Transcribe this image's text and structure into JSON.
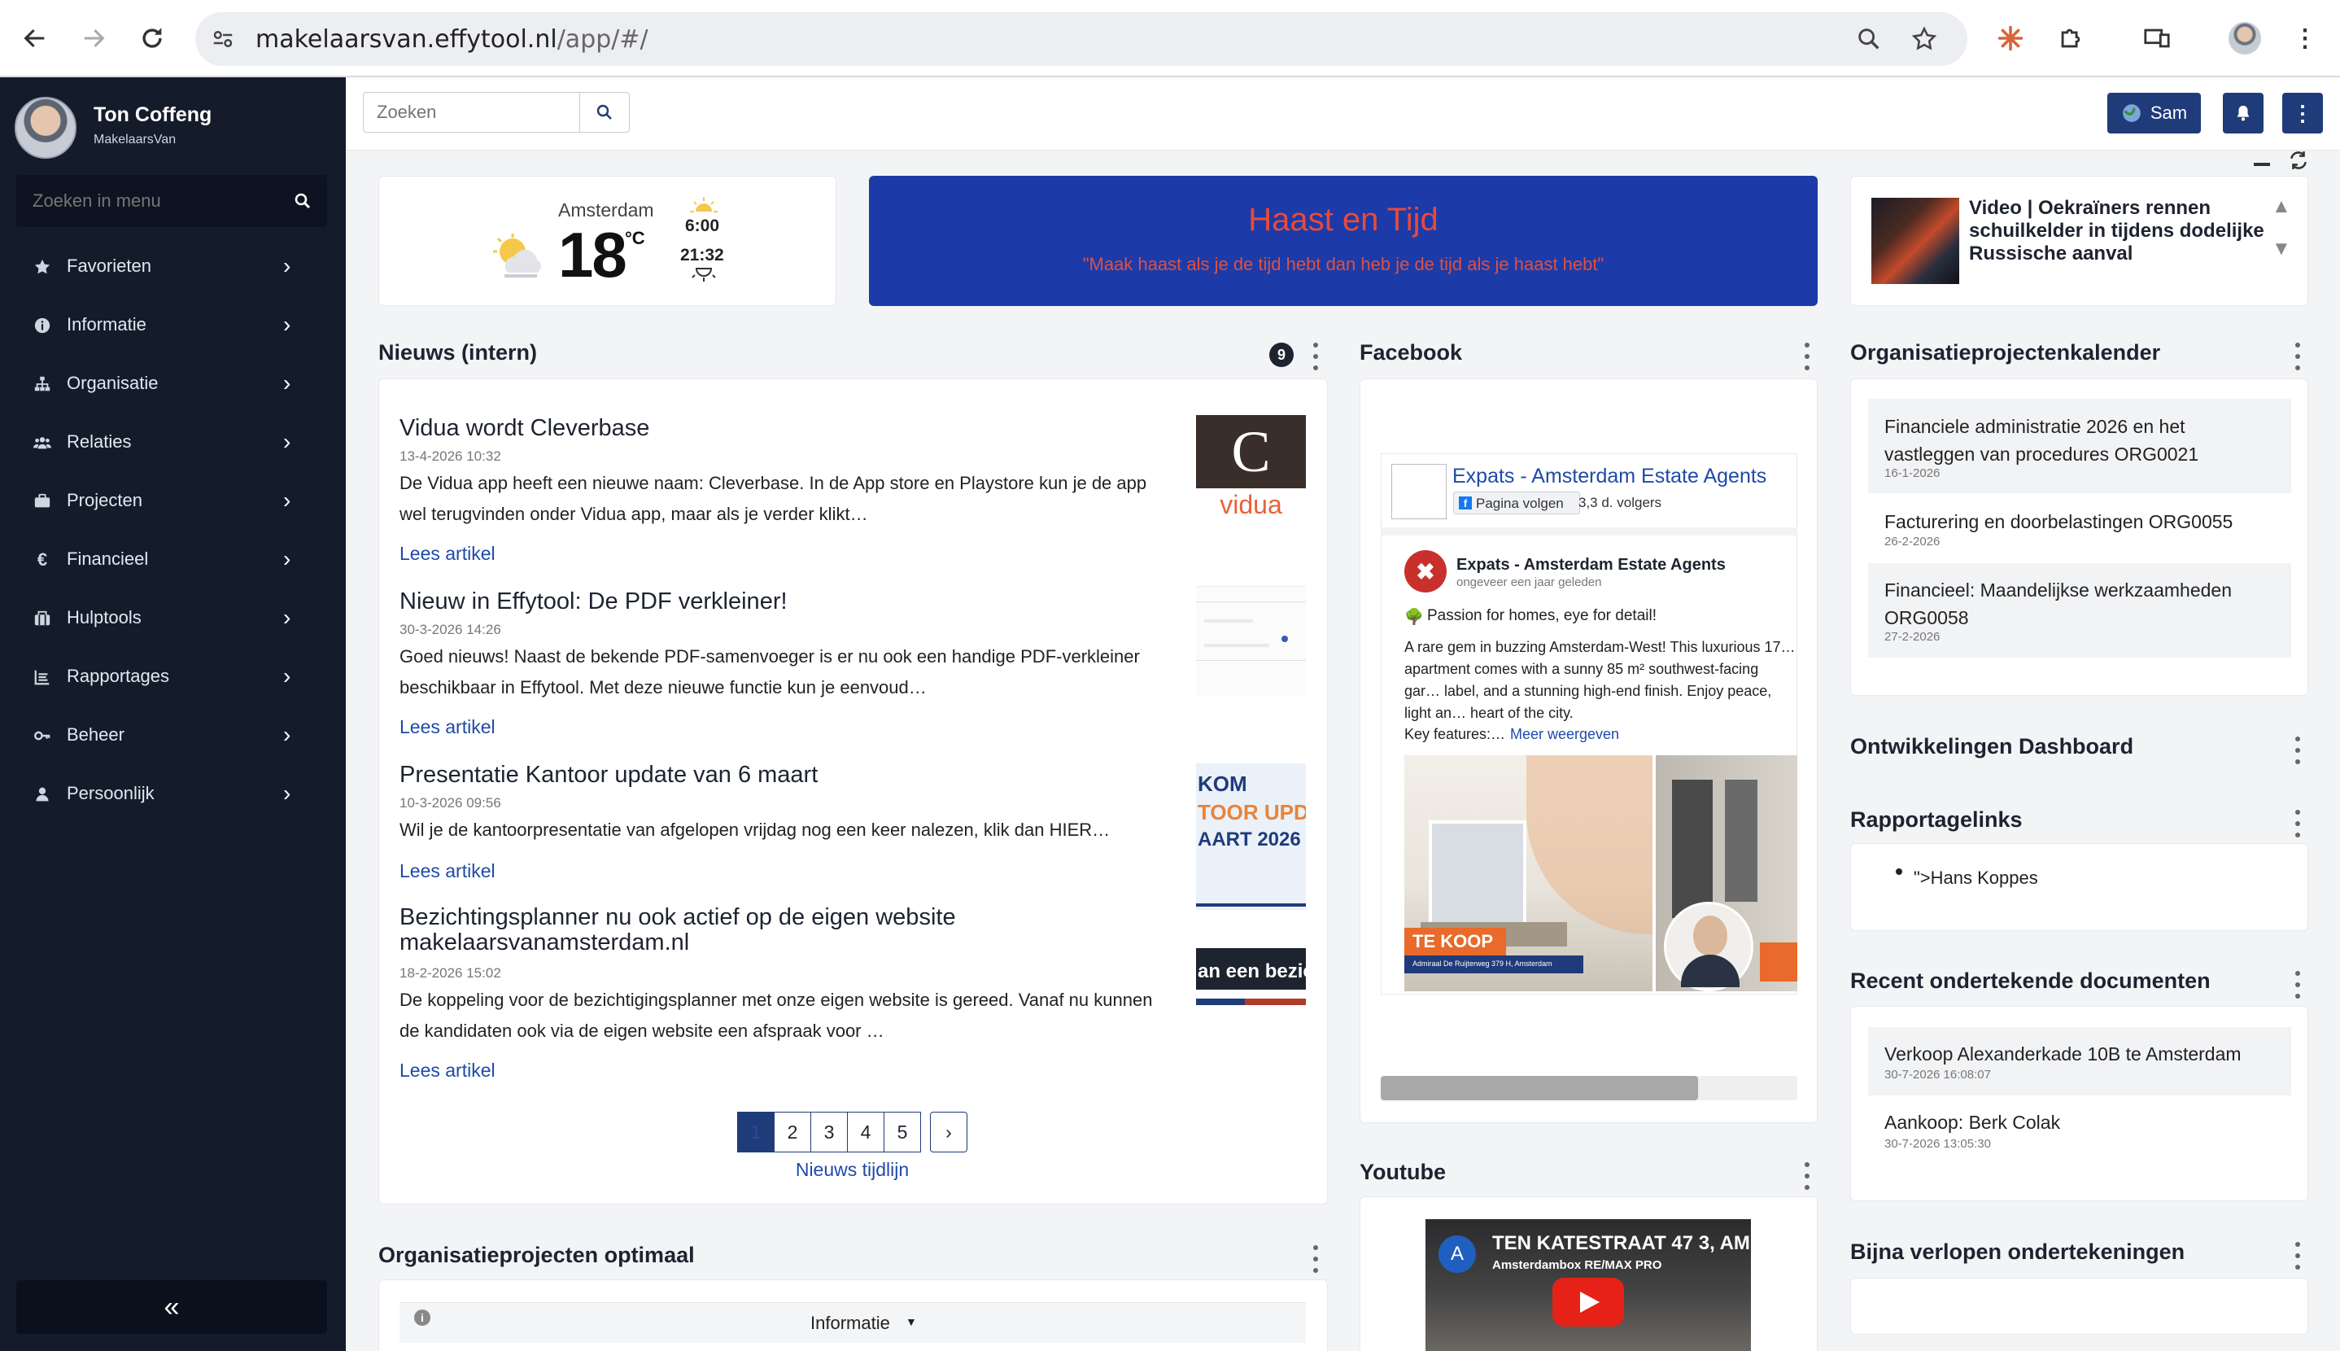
{
  "browser": {
    "url_host": "makelaarsvan.effytool.nl",
    "url_path": "/app/#/"
  },
  "sidebar": {
    "user_name": "Ton Coffeng",
    "company": "MakelaarsVan",
    "search_placeholder": "Zoeken in menu",
    "items": [
      {
        "label": "Favorieten",
        "icon": "star-icon"
      },
      {
        "label": "Informatie",
        "icon": "info-icon"
      },
      {
        "label": "Organisatie",
        "icon": "sitemap-icon"
      },
      {
        "label": "Relaties",
        "icon": "users-icon"
      },
      {
        "label": "Projecten",
        "icon": "briefcase-icon"
      },
      {
        "label": "Financieel",
        "icon": "euro-icon"
      },
      {
        "label": "Hulptools",
        "icon": "toolbox-icon"
      },
      {
        "label": "Rapportages",
        "icon": "list-icon"
      },
      {
        "label": "Beheer",
        "icon": "key-icon"
      },
      {
        "label": "Persoonlijk",
        "icon": "person-icon"
      }
    ],
    "collapse_label": "«"
  },
  "topbar": {
    "search_placeholder": "Zoeken",
    "user_button": "Sam"
  },
  "weather": {
    "city": "Amsterdam",
    "temp": "18",
    "unit": "°C",
    "sunrise": "6:00",
    "sunset": "21:32"
  },
  "quote": {
    "title": "Haast en Tijd",
    "text": "\"Maak haast als je de tijd hebt dan heb je de tijd als je haast hebt\""
  },
  "ticker": {
    "title": "Video | Oekraïners rennen schuilkelder in tijdens dodelijke Russische aanval"
  },
  "news": {
    "title": "Nieuws (intern)",
    "count": "9",
    "link_label": "Lees artikel",
    "items": [
      {
        "title": "Vidua wordt Cleverbase",
        "date": "13-4-2026 10:32",
        "text": "De Vidua app heeft een nieuwe naam: Cleverbase.  In de App store en Playstore kun je de app wel terugvinden onder Vidua app, maar als je verder klikt…",
        "thumb_letter": "C",
        "thumb_brand": "vidua"
      },
      {
        "title": "Nieuw in Effytool: De PDF verkleiner!",
        "date": "30-3-2026 14:26",
        "text": "Goed nieuws! Naast de bekende PDF-samenvoeger is er nu ook een handige PDF-verkleiner beschikbaar in Effytool. Met deze nieuwe functie kun je eenvoud…"
      },
      {
        "title": "Presentatie Kantoor update van 6 maart",
        "date": "10-3-2026 09:56",
        "text": "Wil je de kantoorpresentatie van afgelopen vrijdag nog een keer nalezen, klik dan HIER…",
        "thumb_lines": [
          "KOM",
          "TOOR UPD",
          "AART 2026"
        ]
      },
      {
        "title": "Bezichtingsplanner nu ook actief op de eigen website makelaarsvanamsterdam.nl",
        "date": "18-2-2026 15:02",
        "text": "De koppeling voor de bezichtigingsplanner met onze eigen website is gereed. Vanaf nu kunnen de kandidaten ook via de eigen website een afspraak voor …",
        "thumb_text": "an een bezic"
      }
    ],
    "pages": [
      "1",
      "2",
      "3",
      "4",
      "5"
    ],
    "next_label": "›",
    "timeline_label": "Nieuws tijdlijn"
  },
  "org_optimal": {
    "title": "Organisatieprojecten optimaal",
    "dropdown_label": "Informatie"
  },
  "facebook": {
    "title": "Facebook",
    "page_name": "Expats - Amsterdam Estate Agents",
    "follow_label": "Pagina volgen",
    "followers": "3,3 d. volgers",
    "post_author": "Expats - Amsterdam Estate Agents",
    "post_ago": "ongeveer een jaar geleden",
    "post_line1": "Passion for homes, eye for detail!",
    "post_text": "A rare gem in buzzing Amsterdam-West! This luxurious 17… apartment comes with a sunny 85 m² southwest-facing gar… label, and a stunning high-end finish. Enjoy peace, light an… heart of the city.",
    "key_features": "Key features:…",
    "more_label": "Meer weergeven",
    "badge": "TE KOOP",
    "address": "Admiraal De Ruijterweg 379 H, Amsterdam"
  },
  "youtube": {
    "title": "Youtube",
    "video_title": "TEN KATESTRAAT 47 3, AM",
    "channel": "Amsterdambox RE/MAX PRO",
    "channel_initial": "A"
  },
  "calendar": {
    "title": "Organisatieprojectenkalender",
    "items": [
      {
        "title": "Financiele administratie 2026 en het vastleggen van procedures ORG0021",
        "date": "16-1-2026"
      },
      {
        "title": "Facturering en doorbelastingen ORG0055",
        "date": "26-2-2026"
      },
      {
        "title": "Financieel: Maandelijkse werkzaamheden ORG0058",
        "date": "27-2-2026"
      }
    ]
  },
  "dev_dashboard": {
    "title": "Ontwikkelingen Dashboard"
  },
  "report_links": {
    "title": "Rapportagelinks",
    "items": [
      "\">Hans Koppes"
    ]
  },
  "recent_docs": {
    "title": "Recent ondertekende documenten",
    "items": [
      {
        "title": "Verkoop Alexanderkade 10B te Amsterdam",
        "date": "30-7-2026 16:08:07"
      },
      {
        "title": "Aankoop: Berk Colak",
        "date": "30-7-2026 13:05:30"
      }
    ]
  },
  "expiring": {
    "title": "Bijna verlopen ondertekeningen"
  },
  "colors": {
    "sidebar": "#141c2b",
    "accent": "#1f3b7a",
    "quote_bg": "#1c3aa8",
    "quote_text": "#e84a3a",
    "link": "#1f4aa8"
  }
}
